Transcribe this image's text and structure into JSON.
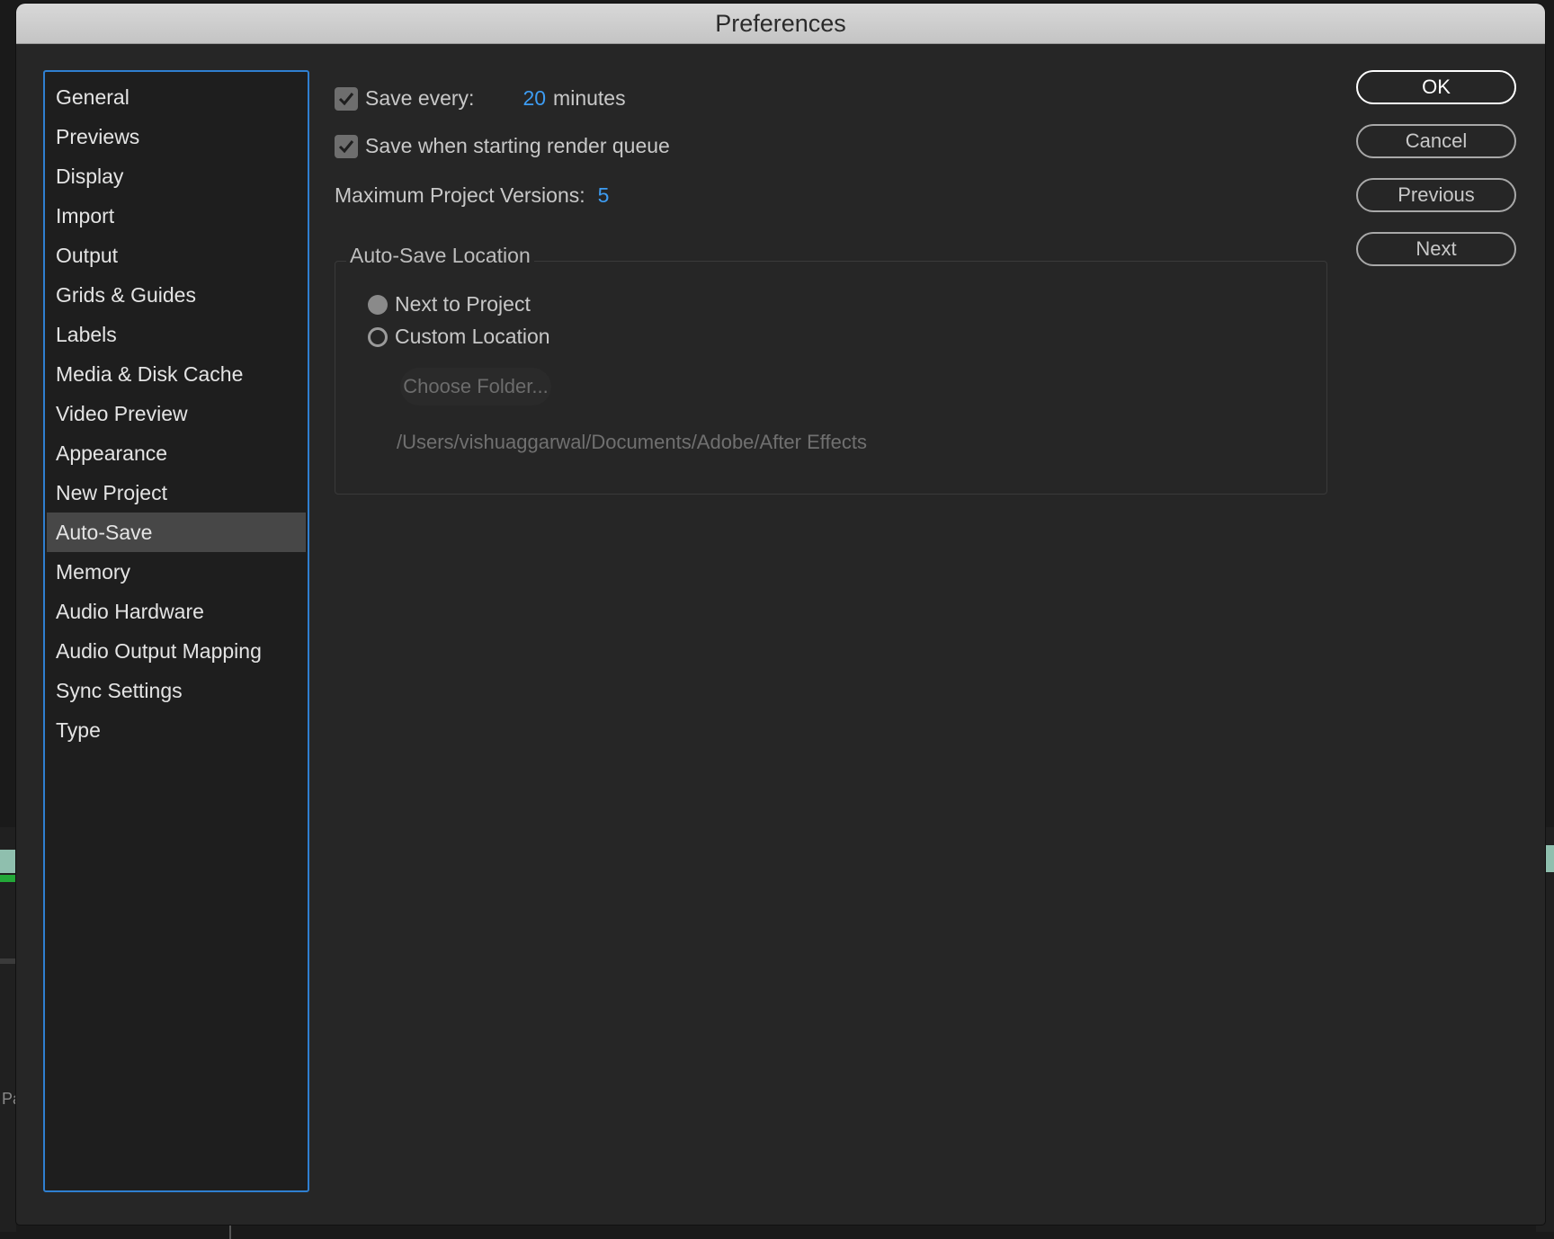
{
  "window": {
    "title": "Preferences"
  },
  "sidebar": {
    "items": [
      {
        "label": "General"
      },
      {
        "label": "Previews"
      },
      {
        "label": "Display"
      },
      {
        "label": "Import"
      },
      {
        "label": "Output"
      },
      {
        "label": "Grids & Guides"
      },
      {
        "label": "Labels"
      },
      {
        "label": "Media & Disk Cache"
      },
      {
        "label": "Video Preview"
      },
      {
        "label": "Appearance"
      },
      {
        "label": "New Project"
      },
      {
        "label": "Auto-Save",
        "selected": true
      },
      {
        "label": "Memory"
      },
      {
        "label": "Audio Hardware"
      },
      {
        "label": "Audio Output Mapping"
      },
      {
        "label": "Sync Settings"
      },
      {
        "label": "Type"
      }
    ]
  },
  "autosave": {
    "save_every_label": "Save every:",
    "save_every_checked": true,
    "save_every_value": "20",
    "save_every_unit": "minutes",
    "render_queue_label": "Save when starting render queue",
    "render_queue_checked": true,
    "max_versions_label": "Maximum Project Versions:",
    "max_versions_value": "5",
    "location_group_label": "Auto-Save Location",
    "option_next_to_project": "Next to Project",
    "option_custom_location": "Custom Location",
    "selected_option": "Next to Project",
    "choose_folder_label": "Choose Folder...",
    "folder_path": "/Users/vishuaggarwal/Documents/Adobe/After Effects"
  },
  "buttons": {
    "ok": "OK",
    "cancel": "Cancel",
    "previous": "Previous",
    "next": "Next"
  },
  "background": {
    "partial_text": "Pa"
  },
  "colors": {
    "accent": "#3d9cf2",
    "sidebar_border": "#2f7fd0",
    "selected_bg": "#474747"
  }
}
